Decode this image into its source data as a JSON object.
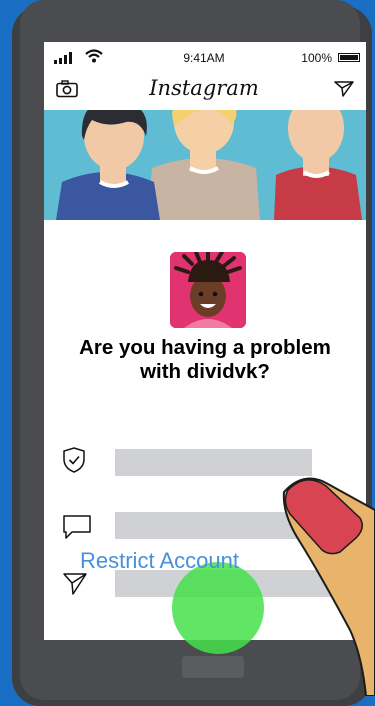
{
  "status_bar": {
    "time": "9:41AM",
    "battery": "100%"
  },
  "nav_bar": {
    "brand": "Instagram"
  },
  "dialog": {
    "headline": "Are you having a problem with dividvk?",
    "action_label": "Restrict Account"
  },
  "colors": {
    "background": "#1a6fc4",
    "phone_body": "#3d3f42",
    "banner": "#5fbcd3",
    "avatar_bg": "#e0336f",
    "action_text": "#4a8fd9",
    "tap_indicator": "#44e04a",
    "finger_nail": "#d94452",
    "hand_skin": "#e8b36a"
  },
  "icons": [
    "signal-icon",
    "wifi-icon",
    "battery-icon",
    "camera-icon",
    "send-icon",
    "shield-check-icon",
    "comment-icon",
    "send-icon"
  ]
}
